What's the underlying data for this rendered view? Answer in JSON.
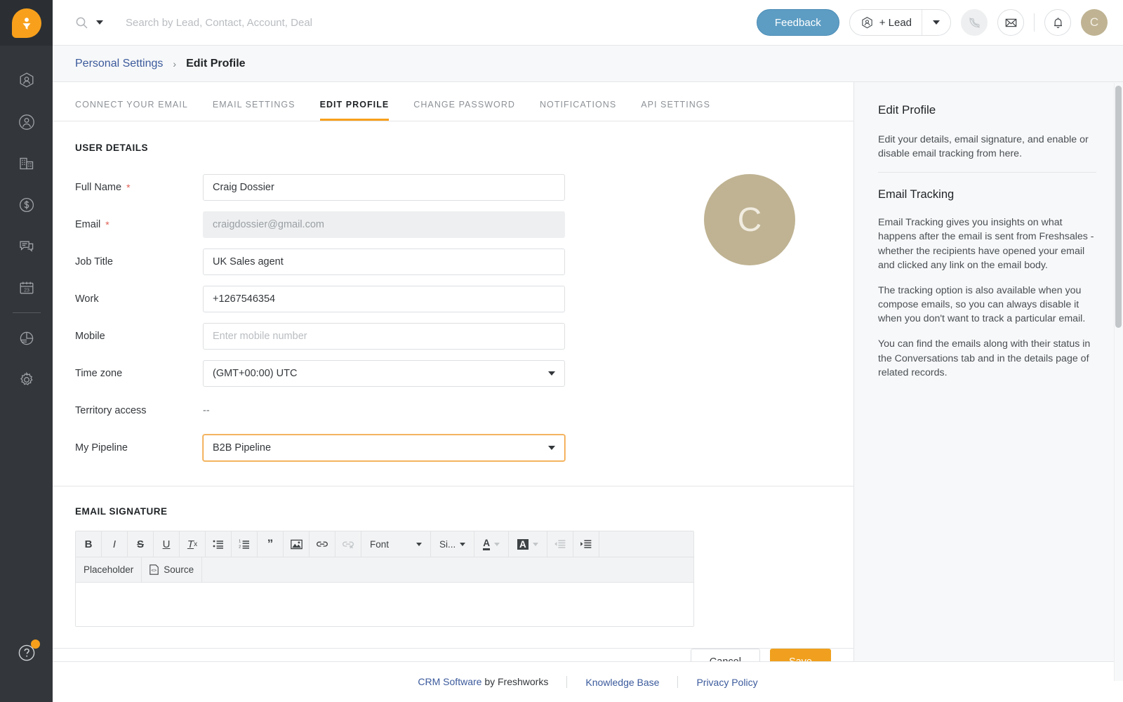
{
  "brand": {
    "accent": "#f8a01c",
    "link": "#3b5a9c",
    "avatar_bg": "#bfb393",
    "save_bg": "#f0a01e",
    "feedback_bg": "#5d9dc4"
  },
  "topbar": {
    "search_placeholder": "Search by Lead, Contact, Account, Deal",
    "feedback_label": "Feedback",
    "lead_label": "+ Lead",
    "avatar_initial": "C"
  },
  "sidebar": {
    "items": [
      {
        "name": "leads",
        "icon": "hexagon-person-icon"
      },
      {
        "name": "contacts",
        "icon": "circle-person-icon"
      },
      {
        "name": "accounts",
        "icon": "building-icon"
      },
      {
        "name": "deals",
        "icon": "dollar-circle-icon"
      },
      {
        "name": "conversations",
        "icon": "chat-icon"
      },
      {
        "name": "calendar",
        "icon": "calendar-icon"
      },
      {
        "name": "reports",
        "icon": "pie-chart-icon"
      },
      {
        "name": "settings",
        "icon": "gear-icon"
      }
    ],
    "calendar_day": "23",
    "help_icon": "question-circle-icon"
  },
  "breadcrumb": {
    "parent": "Personal Settings",
    "separator": "›",
    "current": "Edit Profile"
  },
  "tabs": [
    {
      "label": "Connect your email",
      "active": false
    },
    {
      "label": "Email Settings",
      "active": false
    },
    {
      "label": "Edit Profile",
      "active": true
    },
    {
      "label": "Change Password",
      "active": false
    },
    {
      "label": "Notifications",
      "active": false
    },
    {
      "label": "API Settings",
      "active": false
    }
  ],
  "user_details": {
    "section_title": "USER DETAILS",
    "fields": [
      {
        "label": "Full Name",
        "required": true,
        "type": "text",
        "value": "Craig Dossier",
        "placeholder": ""
      },
      {
        "label": "Email",
        "required": true,
        "type": "readonly",
        "value": "craigdossier@gmail.com",
        "placeholder": ""
      },
      {
        "label": "Job Title",
        "required": false,
        "type": "text",
        "value": "UK Sales agent",
        "placeholder": ""
      },
      {
        "label": "Work",
        "required": false,
        "type": "text",
        "value": "+1267546354",
        "placeholder": ""
      },
      {
        "label": "Mobile",
        "required": false,
        "type": "text",
        "value": "",
        "placeholder": "Enter mobile number"
      },
      {
        "label": "Time zone",
        "required": false,
        "type": "select",
        "value": "(GMT+00:00) UTC",
        "placeholder": ""
      },
      {
        "label": "Territory access",
        "required": false,
        "type": "plain",
        "value": "--",
        "placeholder": ""
      },
      {
        "label": "My Pipeline",
        "required": false,
        "type": "select-focused",
        "value": "B2B Pipeline",
        "placeholder": ""
      }
    ],
    "profile_avatar_initial": "C"
  },
  "email_signature": {
    "section_title": "EMAIL SIGNATURE",
    "toolbar": [
      {
        "name": "bold-button",
        "glyph": "B",
        "kind": "icon",
        "style": "bold",
        "disabled": false
      },
      {
        "name": "italic-button",
        "glyph": "I",
        "kind": "icon",
        "style": "italic",
        "disabled": false
      },
      {
        "name": "strikethrough-button",
        "glyph": "S",
        "kind": "icon",
        "style": "strike",
        "disabled": false
      },
      {
        "name": "underline-button",
        "glyph": "U",
        "kind": "icon",
        "style": "underline",
        "disabled": false
      },
      {
        "name": "remove-format-button",
        "glyph": "Tx",
        "kind": "icon",
        "style": "removefmt",
        "disabled": false
      },
      {
        "name": "bulleted-list-button",
        "glyph": "☰",
        "kind": "svg-ul",
        "disabled": false
      },
      {
        "name": "numbered-list-button",
        "glyph": "☰",
        "kind": "svg-ol",
        "disabled": false
      },
      {
        "name": "blockquote-button",
        "glyph": "”",
        "kind": "icon",
        "style": "quote",
        "disabled": false
      },
      {
        "name": "insert-image-button",
        "glyph": "⛰",
        "kind": "svg-image",
        "disabled": false
      },
      {
        "name": "insert-link-button",
        "glyph": "⚭",
        "kind": "svg-link",
        "disabled": false
      },
      {
        "name": "unlink-button",
        "glyph": "⚭",
        "kind": "svg-unlink",
        "disabled": true
      }
    ],
    "font_label": "Font",
    "size_label": "Si...",
    "text_color_name": "text-color-button",
    "bg_color_name": "background-color-button",
    "outdent_name": "decrease-indent-button",
    "indent_name": "increase-indent-button",
    "placeholder_label": "Placeholder",
    "source_label": "Source",
    "body_value": ""
  },
  "actions": {
    "cancel_label": "Cancel",
    "save_label": "Save"
  },
  "right_panel": {
    "title": "Edit Profile",
    "intro": "Edit your details, email signature, and enable or disable email tracking from here.",
    "section_title": "Email Tracking",
    "paragraphs": [
      "Email Tracking gives you insights on what happens after the email is sent from Freshsales - whether the recipients have opened your email and clicked any link on the email body.",
      "The tracking option is also available when you compose emails, so you can always disable it when you don't want to track a particular email.",
      "You can find the emails along with their status in the Conversations tab and in the details page of related records."
    ]
  },
  "footer": {
    "crm_link": "CRM Software",
    "crm_suffix": " by Freshworks",
    "kb_link": "Knowledge Base",
    "privacy_link": "Privacy Policy"
  }
}
